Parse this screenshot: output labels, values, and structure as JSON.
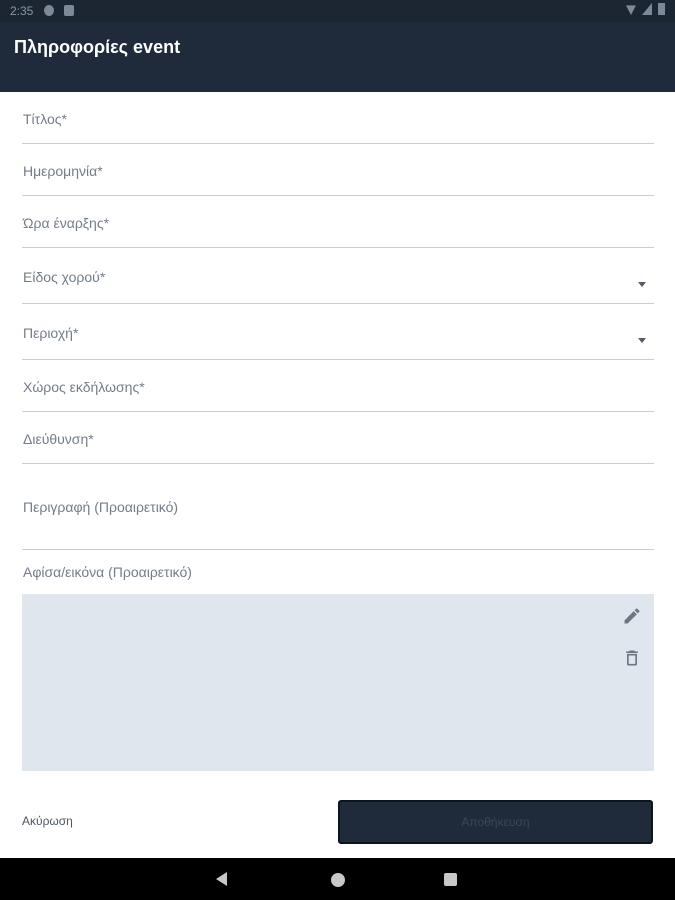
{
  "status_bar": {
    "time": "2:35"
  },
  "app_bar": {
    "title": "Πληροφορίες event"
  },
  "form": {
    "fields": [
      {
        "label": "Τίτλος*"
      },
      {
        "label": "Ημερομηνία*"
      },
      {
        "label": "Ώρα έναρξης*"
      },
      {
        "label": "Είδος χορού*",
        "dropdown": true
      },
      {
        "label": "Περιοχή*",
        "dropdown": true
      },
      {
        "label": "Χώρος εκδήλωσης*"
      },
      {
        "label": "Διεύθυνση*"
      },
      {
        "label": "Περιγραφή (Προαιρετικό)"
      }
    ],
    "poster_label": "Αφίσα/εικόνα (Προαιρετικό)",
    "poster_actions": {
      "edit_icon": "pencil-icon",
      "delete_icon": "trash-icon"
    }
  },
  "actions": {
    "cancel_label": "Ακύρωση",
    "submit_label": "Αποθήκευση"
  },
  "colors": {
    "app_bar": "#1f2b3b",
    "poster_bg": "#e0e6ee",
    "divider": "#c9ced5"
  }
}
